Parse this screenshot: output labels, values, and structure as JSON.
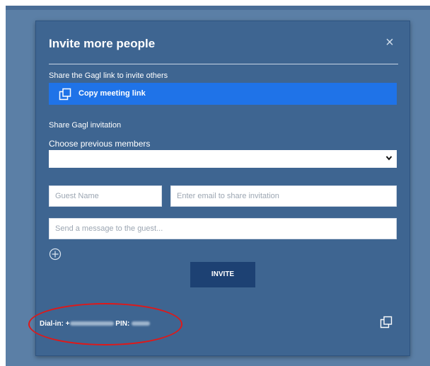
{
  "dialog": {
    "title": "Invite more people",
    "close_symbol": "×",
    "share_link_label": "Share the Gagl link to invite others",
    "copy_link_button": "Copy meeting link",
    "share_invitation_label": "Share Gagl invitation",
    "choose_members_label": "Choose previous members",
    "members_select_value": "",
    "guest_name_placeholder": "Guest Name",
    "email_placeholder": "Enter email to share invitation",
    "message_placeholder": "Send a message to the guest...",
    "invite_button": "INVITE",
    "dial_in_label": "Dial-in:",
    "dial_in_prefix": "+",
    "pin_label": "PIN:"
  },
  "colors": {
    "backdrop": "#5b7fa6",
    "modal_bg": "#3e6591",
    "accent": "#1f73e8",
    "invite_button": "#1d4173",
    "annotation": "#e01818"
  },
  "icons": [
    "close-icon",
    "copy-icon",
    "chevron-down-icon",
    "plus-circle-icon",
    "copy-icon"
  ]
}
